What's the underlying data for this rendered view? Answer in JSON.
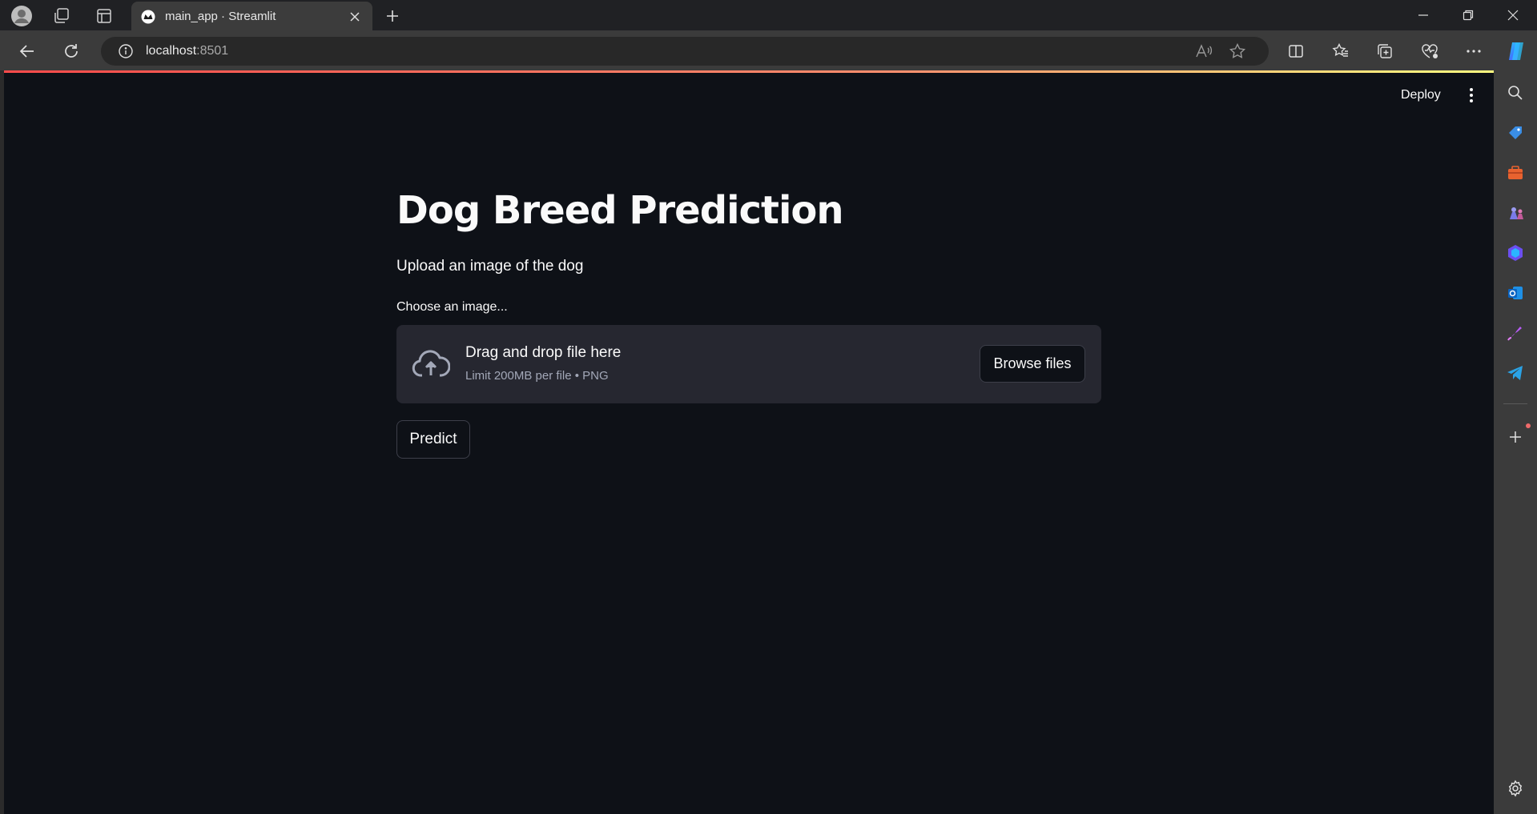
{
  "browser": {
    "tab_title": "main_app · Streamlit",
    "url_host": "localhost",
    "url_port": ":8501"
  },
  "app": {
    "deploy_label": "Deploy",
    "title": "Dog Breed Prediction",
    "subtitle": "Upload an image of the dog",
    "uploader_label": "Choose an image...",
    "dropzone_text": "Drag and drop file here",
    "dropzone_limit": "Limit 200MB per file • PNG",
    "browse_label": "Browse files",
    "predict_label": "Predict"
  },
  "icons": {
    "tabbar": [
      "profile-icon",
      "workspaces-icon",
      "tab-actions-icon",
      "streamlit-favicon-icon",
      "close-icon",
      "new-tab-icon"
    ],
    "window": [
      "minimize-icon",
      "restore-icon",
      "close-window-icon"
    ],
    "toolbar": [
      "back-icon",
      "refresh-icon",
      "info-icon",
      "read-aloud-icon",
      "favorite-star-icon",
      "split-screen-icon",
      "favorites-icon",
      "collections-icon",
      "browser-essentials-icon",
      "more-icon",
      "copilot-icon"
    ],
    "sidebar": [
      "search-icon",
      "shopping-icon",
      "tools-icon",
      "games-icon",
      "copilot-sidebar-icon",
      "outlook-icon",
      "designer-icon",
      "telegram-icon",
      "add-icon",
      "settings-icon"
    ]
  },
  "colors": {
    "page_bg": "#0e1117",
    "dropzone_bg": "#262730",
    "accent_gradient_start": "#ff4b4b",
    "accent_gradient_end": "#fffd80"
  }
}
